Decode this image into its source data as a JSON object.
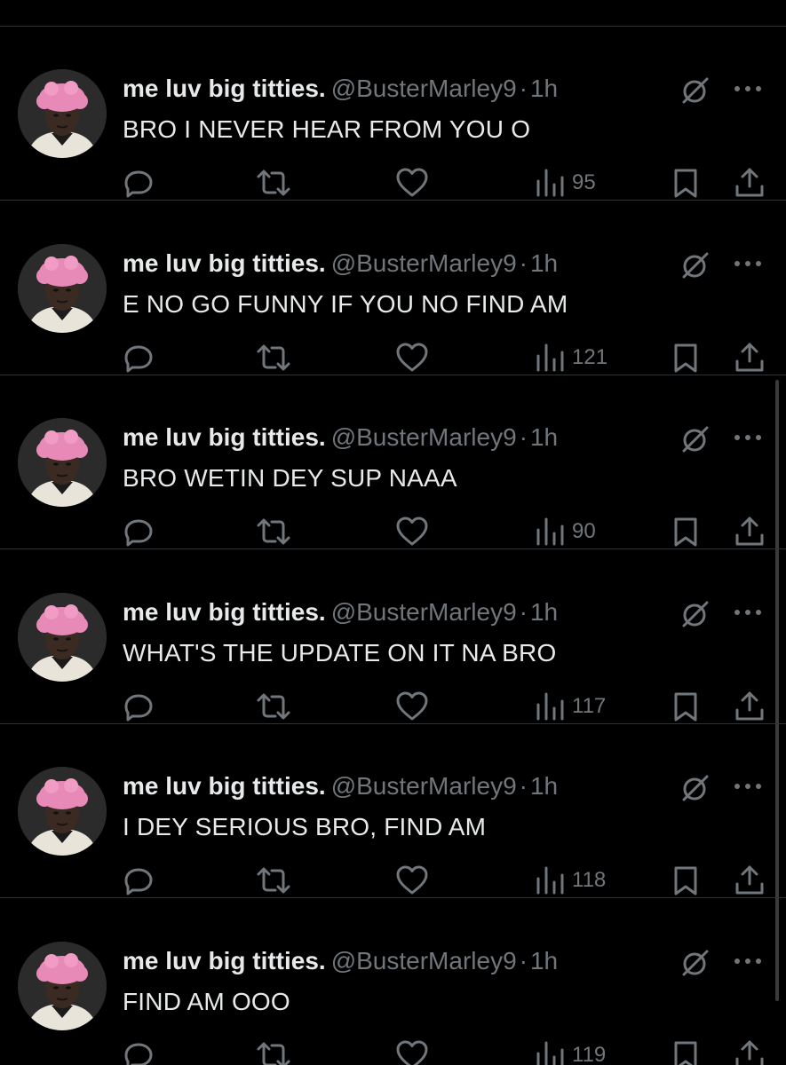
{
  "author": {
    "display_name": "me luv big titties.",
    "handle": "@BusterMarley9",
    "separator": "·",
    "time": "1h",
    "avatar_icon": "profile-photo"
  },
  "colors": {
    "background": "#000000",
    "text_primary": "#e7e9ea",
    "text_secondary": "#71767b",
    "divider": "#2f3336"
  },
  "tweets": [
    {
      "text": "BRO I NEVER HEAR FROM YOU O",
      "views": "95"
    },
    {
      "text": "E NO GO FUNNY IF YOU NO FIND AM",
      "views": "121"
    },
    {
      "text": "BRO WETIN DEY SUP NAAA",
      "views": "90"
    },
    {
      "text": "WHAT'S THE UPDATE ON IT NA BRO",
      "views": "117"
    },
    {
      "text": "I DEY SERIOUS BRO, FIND AM",
      "views": "118"
    },
    {
      "text": "FIND AM OOO",
      "views": "119"
    }
  ]
}
